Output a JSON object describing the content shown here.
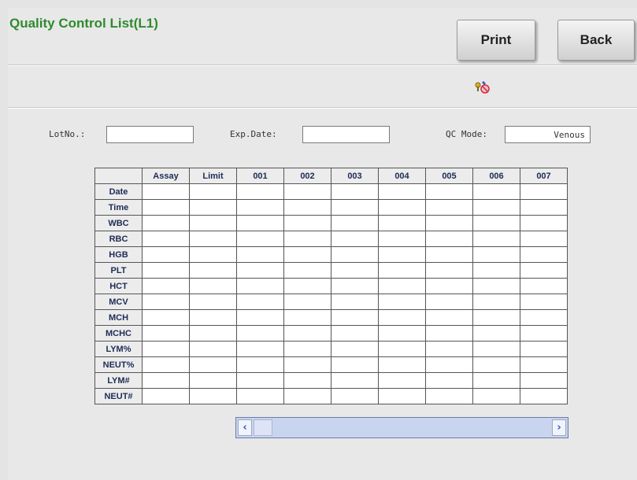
{
  "header": {
    "title": "Quality Control List(L1)",
    "print_label": "Print",
    "back_label": "Back"
  },
  "toolbar": {
    "icon": "settings-wrench-icon"
  },
  "fields": {
    "lot_label": "LotNo.:",
    "lot_value": "",
    "exp_label": "Exp.Date:",
    "exp_value": "",
    "mode_label": "QC Mode:",
    "mode_value": "Venous"
  },
  "table": {
    "columns": [
      "Assay",
      "Limit",
      "001",
      "002",
      "003",
      "004",
      "005",
      "006",
      "007"
    ],
    "rows": [
      "Date",
      "Time",
      "WBC",
      "RBC",
      "HGB",
      "PLT",
      "HCT",
      "MCV",
      "MCH",
      "MCHC",
      "LYM%",
      "NEUT%",
      "LYM#",
      "NEUT#"
    ]
  },
  "scrollbar": {
    "left_arrow": "‹",
    "right_arrow": "›"
  },
  "colors": {
    "title": "#2e8b2e",
    "scroll_track": "#c9d4ef",
    "arrow": "#2c55c7"
  }
}
